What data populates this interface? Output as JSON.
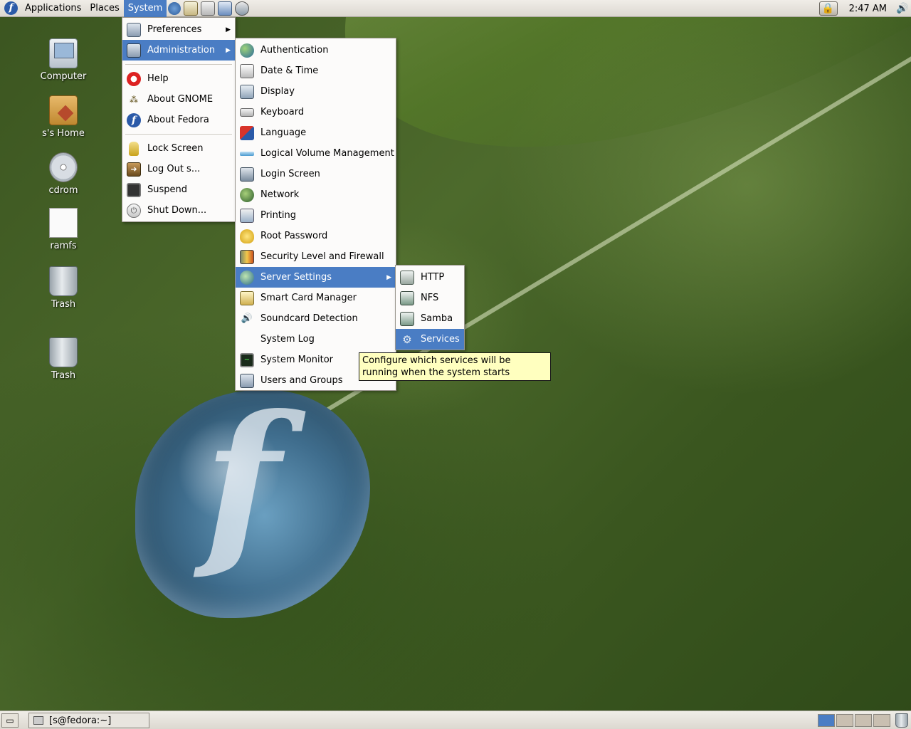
{
  "top_panel": {
    "menus": [
      "Applications",
      "Places",
      "System"
    ],
    "clock": "2:47 AM"
  },
  "desktop_icons": [
    "Computer",
    "s's Home",
    "cdrom",
    "ramfs",
    "Trash",
    "Trash"
  ],
  "system_menu": {
    "items": [
      "Preferences",
      "Administration",
      "Help",
      "About GNOME",
      "About Fedora",
      "Lock Screen",
      "Log Out s...",
      "Suspend",
      "Shut Down..."
    ]
  },
  "administration_menu": {
    "items": [
      "Authentication",
      "Date & Time",
      "Display",
      "Keyboard",
      "Language",
      "Logical Volume Management",
      "Login Screen",
      "Network",
      "Printing",
      "Root Password",
      "Security Level and Firewall",
      "Server Settings",
      "Smart Card Manager",
      "Soundcard Detection",
      "System Log",
      "System Monitor",
      "Users and Groups"
    ]
  },
  "server_settings_menu": {
    "items": [
      "HTTP",
      "NFS",
      "Samba",
      "Services"
    ]
  },
  "tooltip": {
    "text": "Configure which services will be running when the system starts"
  },
  "bottom_panel": {
    "task": "[s@fedora:~]"
  },
  "colors": {
    "selection": "#4a7dc4",
    "tooltip_bg": "#ffffbf",
    "panel_bg": "#e6e2da"
  }
}
